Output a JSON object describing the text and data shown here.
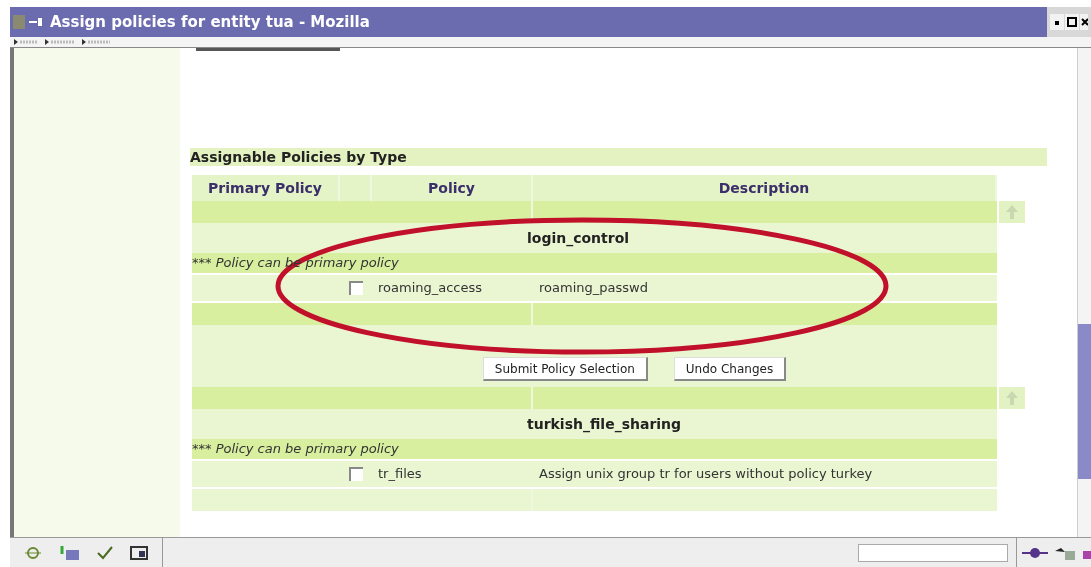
{
  "window": {
    "title": "Assign policies for entity tua - Mozilla"
  },
  "section_heading": "Assignable Policies by Type",
  "table": {
    "columns": [
      "Primary Policy",
      "",
      "Policy",
      "Description"
    ],
    "blocks": [
      {
        "kind": "group",
        "name": "login_control",
        "note": "*** Policy can be primary policy",
        "policies": [
          {
            "checked": false,
            "name": "roaming_access",
            "description": "roaming_passwd"
          }
        ]
      },
      {
        "kind": "buttons",
        "buttons": [
          "Submit Policy Selection",
          "Undo Changes"
        ]
      },
      {
        "kind": "group",
        "name": "turkish_file_sharing",
        "note": "*** Policy can be primary policy",
        "policies": [
          {
            "checked": false,
            "name": "tr_files",
            "description": "Assign unix group tr for users without policy turkey"
          }
        ]
      }
    ]
  }
}
